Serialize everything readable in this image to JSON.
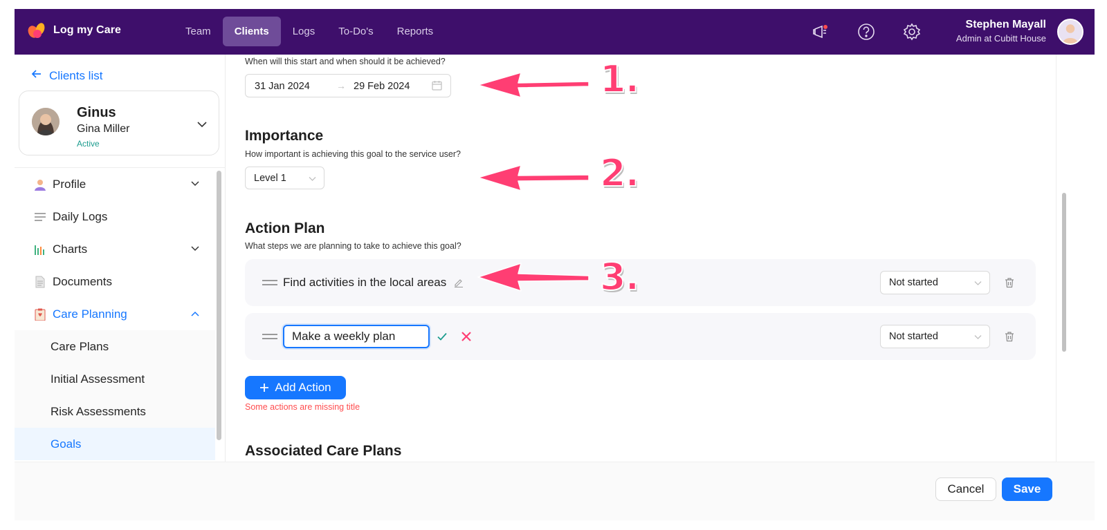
{
  "app": {
    "name": "Log my Care",
    "brand_color": "#3e0f6b",
    "accent_color": "#1677ff"
  },
  "nav": [
    {
      "label": "Team",
      "active": false
    },
    {
      "label": "Clients",
      "active": true
    },
    {
      "label": "Logs",
      "active": false
    },
    {
      "label": "To-Do's",
      "active": false
    },
    {
      "label": "Reports",
      "active": false
    }
  ],
  "topbar": {
    "icons": [
      "announcement-icon",
      "help-icon",
      "settings-icon"
    ],
    "user_name": "Stephen Mayall",
    "user_role": "Admin at Cubitt House"
  },
  "sidebar": {
    "back_label": "Clients list",
    "client": {
      "nickname": "Ginus",
      "full_name": "Gina Miller",
      "status": "Active"
    },
    "menu": [
      {
        "label": "Profile",
        "icon": "person-icon",
        "expandable": true
      },
      {
        "label": "Daily Logs",
        "icon": "lines-icon",
        "expandable": false
      },
      {
        "label": "Charts",
        "icon": "bar-chart-icon",
        "expandable": true
      },
      {
        "label": "Documents",
        "icon": "document-icon",
        "expandable": false
      },
      {
        "label": "Care Planning",
        "icon": "clipboard-icon",
        "expandable": true,
        "open": true
      }
    ],
    "submenu": [
      {
        "label": "Care Plans",
        "active": false
      },
      {
        "label": "Initial Assessment",
        "active": false
      },
      {
        "label": "Risk Assessments",
        "active": false
      },
      {
        "label": "Goals",
        "active": true
      }
    ]
  },
  "main": {
    "dates": {
      "question": "When will this start and when should it be achieved?",
      "start": "31 Jan 2024",
      "end": "29 Feb 2024"
    },
    "importance": {
      "title": "Importance",
      "question": "How important is achieving this goal to the service user?",
      "value": "Level 1"
    },
    "action_plan": {
      "title": "Action Plan",
      "question": "What steps we are planning to take to achieve this goal?",
      "actions": [
        {
          "title": "Find activities in the local areas",
          "status": "Not started",
          "editing": false
        },
        {
          "title": "Make a weekly plan",
          "status": "Not started",
          "editing": true
        }
      ],
      "add_label": "Add Action",
      "error": "Some actions are missing title"
    },
    "associated": {
      "title": "Associated Care Plans"
    }
  },
  "footer": {
    "cancel_label": "Cancel",
    "save_label": "Save"
  },
  "annotations": [
    {
      "label": "1."
    },
    {
      "label": "2."
    },
    {
      "label": "3."
    }
  ]
}
